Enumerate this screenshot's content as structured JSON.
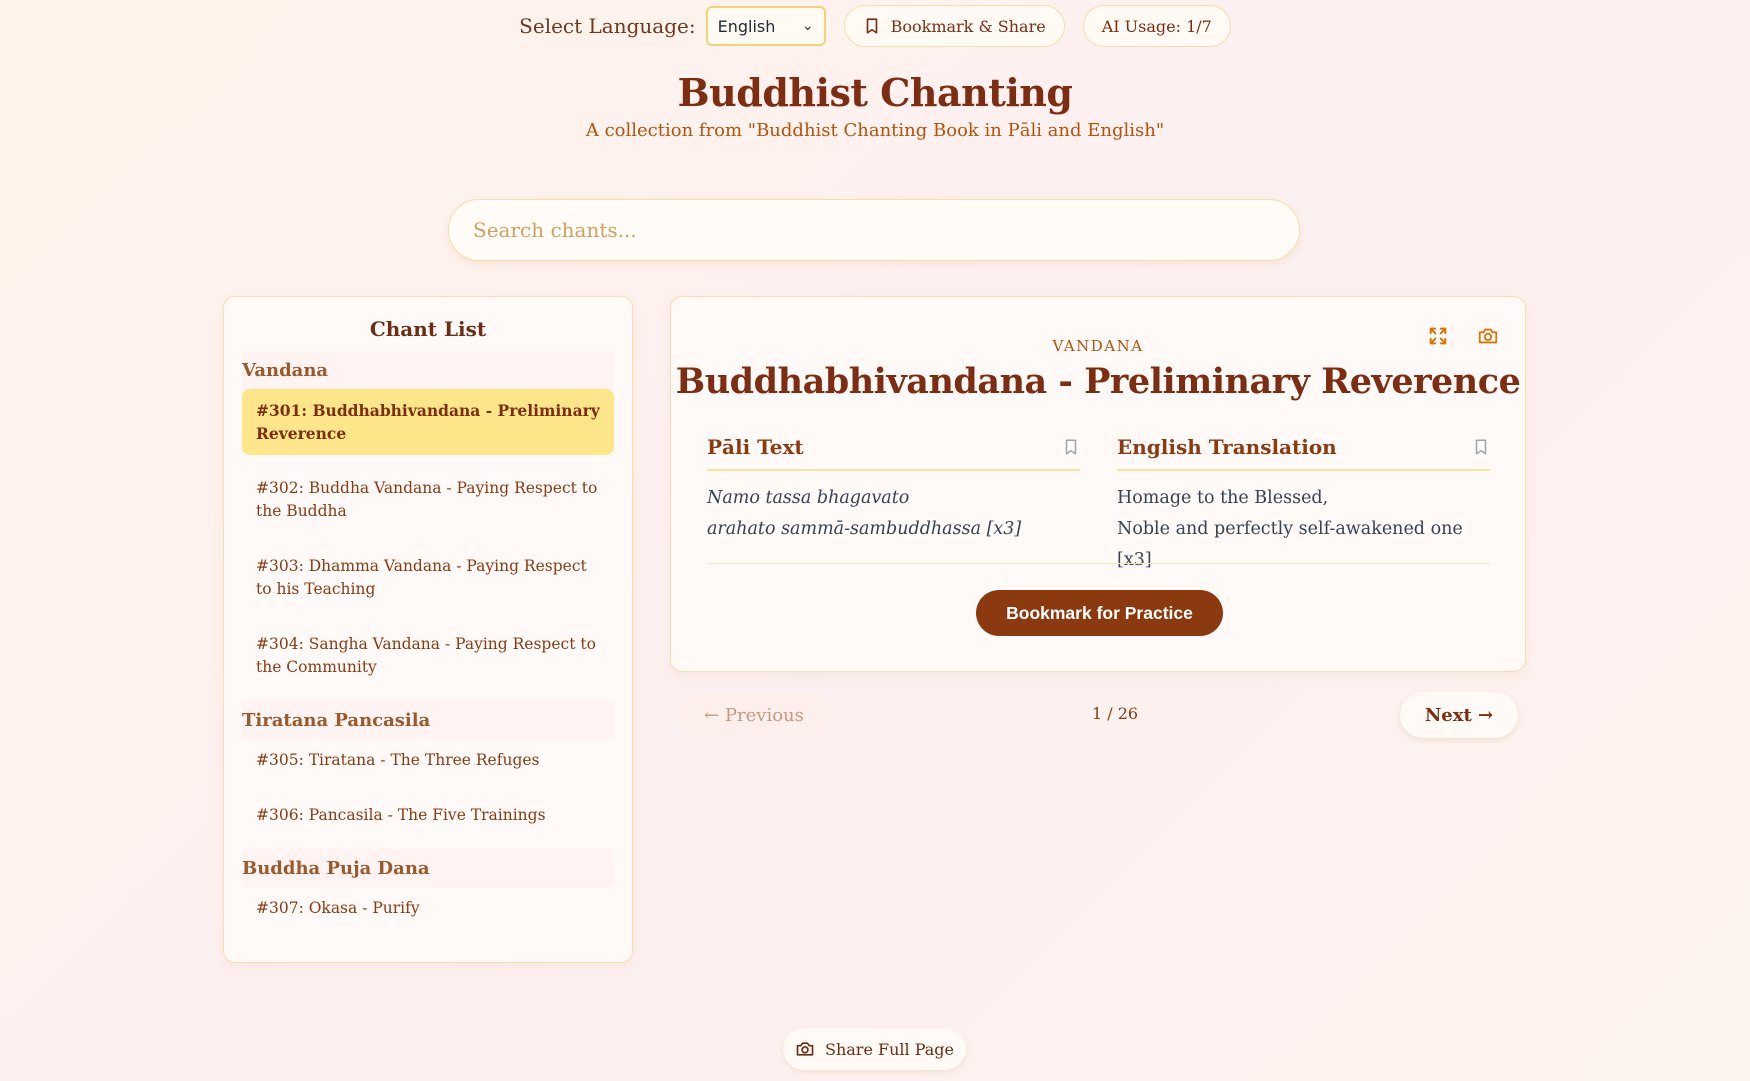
{
  "header": {
    "language_label": "Select Language:",
    "language_selected": "English",
    "bookmark_share_label": "Bookmark & Share",
    "ai_usage_label": "AI Usage: 1/7",
    "title": "Buddhist Chanting",
    "subtitle": "A collection from \"Buddhist Chanting Book in Pāli and English\""
  },
  "search": {
    "placeholder": "Search chants..."
  },
  "sidebar": {
    "title": "Chant List",
    "groups": [
      {
        "category": "Vandana",
        "items": [
          {
            "label": "#301: Buddhabhivandana - Preliminary Reverence",
            "active": true
          },
          {
            "label": "#302: Buddha Vandana - Paying Respect to the Buddha"
          },
          {
            "label": "#303: Dhamma Vandana - Paying Respect to his Teaching"
          },
          {
            "label": "#304: Sangha Vandana - Paying Respect to the Community"
          }
        ]
      },
      {
        "category": "Tiratana Pancasila",
        "items": [
          {
            "label": "#305: Tiratana - The Three Refuges"
          },
          {
            "label": "#306: Pancasila - The Five Trainings"
          }
        ]
      },
      {
        "category": "Buddha Puja Dana",
        "items": [
          {
            "label": "#307: Okasa - Purify"
          }
        ]
      }
    ]
  },
  "chant": {
    "category": "VANDANA",
    "title": "Buddhabhivandana - Preliminary Reverence",
    "pali_heading": "Pāli Text",
    "pali_lines": [
      "Namo tassa bhagavato",
      "arahato sammā-sambuddhassa [x3]"
    ],
    "english_heading": "English Translation",
    "english_lines": [
      "Homage to the Blessed,",
      "Noble and perfectly self-awakened one [x3]"
    ],
    "practice_button": "Bookmark for Practice"
  },
  "pager": {
    "previous": "← Previous",
    "count": "1 / 26",
    "next": "Next →"
  },
  "footer": {
    "share_full_page": "Share Full Page"
  },
  "colors": {
    "accent": "#7c2d12",
    "button_bg": "#8b3a0f",
    "active_item": "#fde68a",
    "icon_orange": "#d97706"
  }
}
